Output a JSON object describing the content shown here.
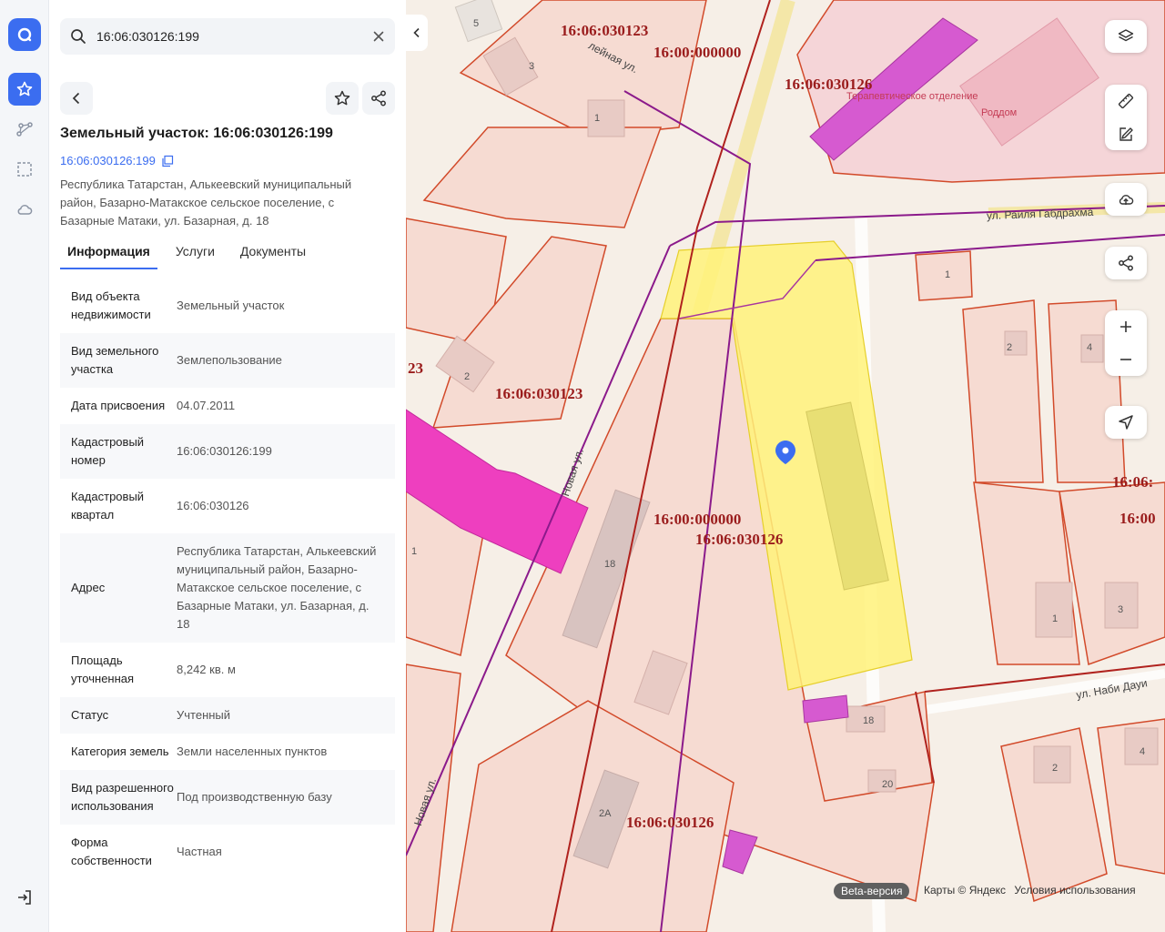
{
  "search": {
    "value": "16:06:030126:199"
  },
  "parcel": {
    "title": "Земельный участок: 16:06:030126:199",
    "cadastral_link": "16:06:030126:199",
    "address": "Республика Татарстан, Алькеевский муниципальный район, Базарно-Матакское сельское поселение, с Базарные Матаки, ул. Базарная, д. 18"
  },
  "tabs": [
    {
      "label": "Информация"
    },
    {
      "label": "Услуги"
    },
    {
      "label": "Документы"
    }
  ],
  "info": [
    {
      "key": "Вид объекта недвижимости",
      "value": "Земельный участок"
    },
    {
      "key": "Вид земельного участка",
      "value": "Землепользование"
    },
    {
      "key": "Дата присвоения",
      "value": "04.07.2011"
    },
    {
      "key": "Кадастровый номер",
      "value": "16:06:030126:199"
    },
    {
      "key": "Кадастровый квартал",
      "value": "16:06:030126"
    },
    {
      "key": "Адрес",
      "value": "Республика Татарстан, Алькеевский муниципальный район, Базарно-Матакское сельское поселение, с Базарные Матаки, ул. Базарная, д. 18"
    },
    {
      "key": "Площадь уточненная",
      "value": "8,242 кв. м"
    },
    {
      "key": "Статус",
      "value": "Учтенный"
    },
    {
      "key": "Категория земель",
      "value": "Земли населенных пунктов"
    },
    {
      "key": "Вид разрешенного использования",
      "value": "Под производственную базу"
    },
    {
      "key": "Форма собственности",
      "value": "Частная"
    }
  ],
  "map": {
    "labels": [
      "16:06:030123",
      "16:00:000000",
      "16:06:030126",
      "23",
      "16:06:030123",
      "16:00:000000",
      "16:06:030126",
      "16:06:030126",
      "16:06:",
      "16:00"
    ],
    "streets": [
      "ул. Раиля Габдрахма",
      "Новая ул.",
      "Новая ул.",
      "ул. Наби Дауи",
      "лейная ул."
    ],
    "pois": [
      "Терапевтическое отделение",
      "Роддом"
    ],
    "house_numbers": [
      "5",
      "3",
      "1",
      "2",
      "18",
      "18",
      "20",
      "2А",
      "1",
      "2",
      "4",
      "1",
      "3",
      "2",
      "4",
      "1"
    ]
  },
  "footer": {
    "beta": "Beta-версия",
    "maps_credit": "Карты © Яндекс",
    "terms": "Условия использования"
  },
  "colors": {
    "accent": "#3b6df0",
    "parcel_fill": "#fff27a",
    "boundary": "#d24a2a",
    "zone": "#8b1a8b",
    "highlight": "#ee3fbf"
  }
}
